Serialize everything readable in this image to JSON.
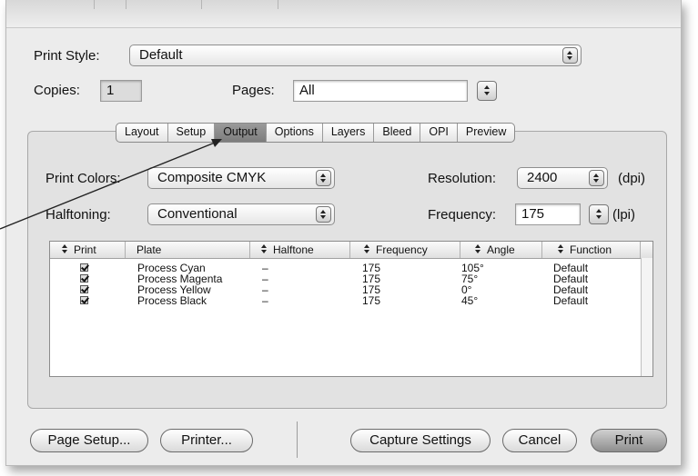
{
  "print_style": {
    "label": "Print Style:",
    "value": "Default"
  },
  "copies": {
    "label": "Copies:",
    "value": "1"
  },
  "pages": {
    "label": "Pages:",
    "value": "All"
  },
  "tabs": [
    "Layout",
    "Setup",
    "Output",
    "Options",
    "Layers",
    "Bleed",
    "OPI",
    "Preview"
  ],
  "selected_tab": "Output",
  "print_colors": {
    "label": "Print Colors:",
    "value": "Composite CMYK"
  },
  "halftoning": {
    "label": "Halftoning:",
    "value": "Conventional"
  },
  "resolution": {
    "label": "Resolution:",
    "value": "2400",
    "unit": "(dpi)"
  },
  "frequency": {
    "label": "Frequency:",
    "value": "175",
    "unit": "(lpi)"
  },
  "table": {
    "columns": [
      "Print",
      "Plate",
      "Halftone",
      "Frequency",
      "Angle",
      "Function"
    ],
    "rows": [
      {
        "print": true,
        "plate": "Process Cyan",
        "halftone": "–",
        "frequency": "175",
        "angle": "105°",
        "function": "Default"
      },
      {
        "print": true,
        "plate": "Process Magenta",
        "halftone": "–",
        "frequency": "175",
        "angle": "75°",
        "function": "Default"
      },
      {
        "print": true,
        "plate": "Process Yellow",
        "halftone": "–",
        "frequency": "175",
        "angle": "0°",
        "function": "Default"
      },
      {
        "print": true,
        "plate": "Process Black",
        "halftone": "–",
        "frequency": "175",
        "angle": "45°",
        "function": "Default"
      }
    ]
  },
  "buttons": {
    "page_setup": "Page Setup...",
    "printer": "Printer...",
    "capture": "Capture Settings",
    "cancel": "Cancel",
    "print": "Print"
  },
  "colors": {
    "dialog_bg": "#ececec",
    "selected_tab": "#8a8a8a",
    "default_button": "#9a9a9a"
  }
}
